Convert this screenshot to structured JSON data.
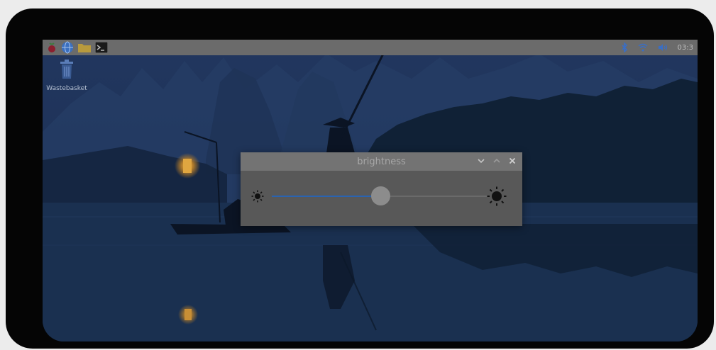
{
  "taskbar": {
    "launcher_icon": "raspberry-menu-icon",
    "browser_icon": "globe-icon",
    "files_icon": "folder-icon",
    "terminal_icon": "terminal-icon",
    "bluetooth_icon": "bluetooth-icon",
    "wifi_icon": "wifi-icon",
    "volume_icon": "volume-icon",
    "clock": "03:3"
  },
  "desktop": {
    "icons": [
      {
        "label": "Wastebasket",
        "icon": "trash-icon"
      }
    ]
  },
  "dialog": {
    "title": "brightness",
    "buttons": [
      "minimize-icon",
      "maximize-icon",
      "close-icon"
    ],
    "brightness_level": 0.5,
    "low_icon": "sun-small-icon",
    "high_icon": "sun-large-icon"
  },
  "colors": {
    "accent": "#2a63b0",
    "taskbar": "#6b6b6b",
    "dialog_bg": "#585858",
    "titlebar": "#737373"
  }
}
